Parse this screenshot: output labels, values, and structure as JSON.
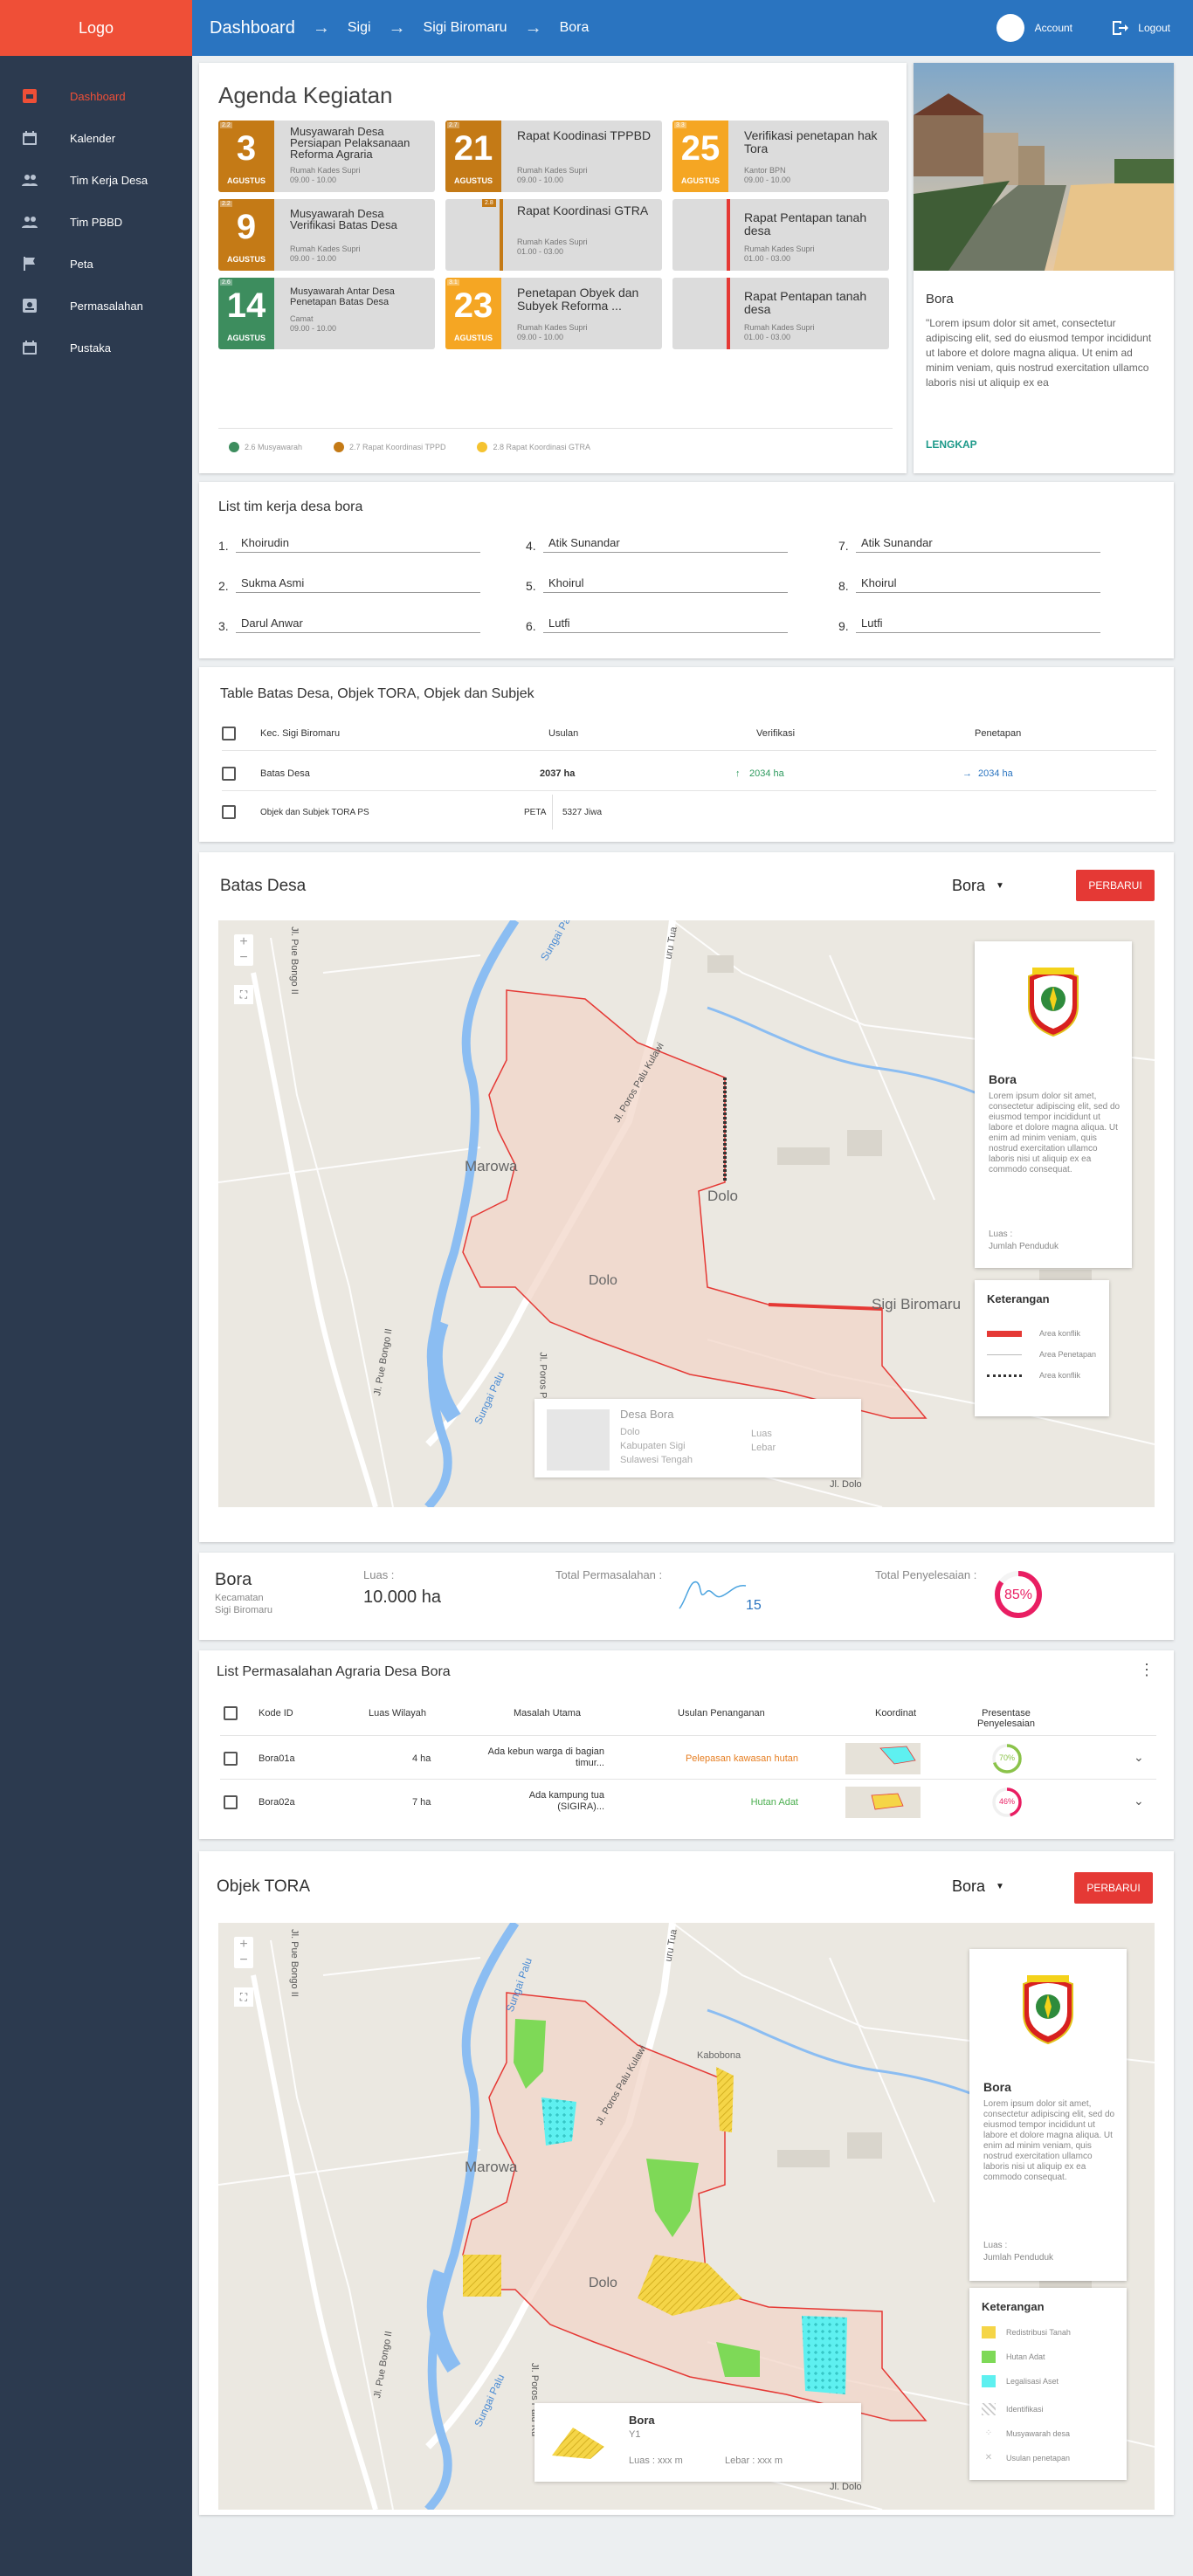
{
  "sidebar": {
    "logo": "Logo",
    "items": [
      {
        "label": "Dashboard",
        "icon": "dashboard-icon",
        "active": true
      },
      {
        "label": "Kalender",
        "icon": "calendar-icon"
      },
      {
        "label": "Tim Kerja Desa",
        "icon": "people-icon"
      },
      {
        "label": "Tim PBBD",
        "icon": "people-icon"
      },
      {
        "label": "Peta",
        "icon": "flag-icon"
      },
      {
        "label": "Permasalahan",
        "icon": "inbox-icon"
      },
      {
        "label": "Pustaka",
        "icon": "calendar-icon"
      }
    ]
  },
  "header": {
    "breadcrumb": [
      "Dashboard",
      "Sigi",
      "Sigi Biromaru",
      "Bora"
    ],
    "account": "Account",
    "logout": "Logout"
  },
  "agenda": {
    "title": "Agenda Kegiatan",
    "events": [
      {
        "badge": "2.2",
        "day": "3",
        "month": "AGUSTUS",
        "title": "Musyawarah Desa Persiapan Pelaksanaan Reforma Agraria",
        "place": "Rumah Kades Supri",
        "time": "09.00 - 10.00",
        "color": "#c47a16"
      },
      {
        "badge": "2.2",
        "day": "9",
        "month": "AGUSTUS",
        "title": "Musyawarah Desa Verifikasi Batas Desa",
        "place": "Rumah Kades Supri",
        "time": "09.00 - 10.00",
        "color": "#c47a16"
      },
      {
        "badge": "2.6",
        "day": "14",
        "month": "AGUSTUS",
        "title": "Musyawarah Antar Desa Penetapan Batas Desa",
        "place": "Camat",
        "time": "09.00 - 10.00",
        "color": "#3d8d5e"
      },
      {
        "badge": "2.7",
        "day": "21",
        "month": "AGUSTUS",
        "title": "Rapat Koodinasi TPPBD",
        "place": "Rumah Kades Supri",
        "time": "09.00 - 10.00",
        "color": "#c47a16"
      },
      {
        "badge": "2.8",
        "day": "",
        "month": "",
        "title": "Rapat Koordinasi GTRA",
        "place": "Rumah Kades Supri",
        "time": "01.00 - 03.00",
        "color": "#c47a16"
      },
      {
        "badge": "3.1",
        "day": "23",
        "month": "AGUSTUS",
        "title": "Penetapan Obyek dan Subyek Reforma ...",
        "place": "Rumah Kades Supri",
        "time": "09.00 - 10.00",
        "color": "#f5a623"
      },
      {
        "badge": "3.3",
        "day": "25",
        "month": "AGUSTUS",
        "title": "Verifikasi penetapan hak Tora",
        "place": "Kantor BPN",
        "time": "09.00 - 10.00",
        "color": "#f5a623"
      },
      {
        "badge": "",
        "day": "",
        "month": "",
        "title": "Rapat Pentapan tanah desa",
        "place": "Rumah Kades Supri",
        "time": "01.00 - 03.00",
        "color": "#e53935"
      },
      {
        "badge": "",
        "day": "",
        "month": "",
        "title": "Rapat Pentapan tanah desa",
        "place": "Rumah Kades Supri",
        "time": "01.00 - 03.00",
        "color": "#e53935"
      }
    ],
    "legend": [
      {
        "label": "2.6 Musyawarah",
        "color": "#3d8d5e"
      },
      {
        "label": "2.7 Rapat Koordinasi TPPD",
        "color": "#c47a16"
      },
      {
        "label": "2.8 Rapat Koordinasi GTRA",
        "color": "#f5c330"
      }
    ]
  },
  "village_card": {
    "name": "Bora",
    "text": "\"Lorem ipsum dolor sit amet, consectetur adipiscing elit, sed do eiusmod tempor incididunt ut labore et dolore magna aliqua. Ut enim ad minim veniam, quis nostrud exercitation ullamco laboris nisi ut aliquip ex ea",
    "link": "LENGKAP"
  },
  "tim": {
    "title": "List tim kerja desa bora",
    "members": [
      {
        "n": "1.",
        "name": "Khoirudin"
      },
      {
        "n": "2.",
        "name": "Sukma Asmi"
      },
      {
        "n": "3.",
        "name": "Darul Anwar"
      },
      {
        "n": "4.",
        "name": "Atik Sunandar"
      },
      {
        "n": "5.",
        "name": "Khoirul"
      },
      {
        "n": "6.",
        "name": "Lutfi"
      },
      {
        "n": "7.",
        "name": "Atik Sunandar"
      },
      {
        "n": "8.",
        "name": "Khoirul"
      },
      {
        "n": "9.",
        "name": "Lutfi"
      }
    ]
  },
  "batas_table": {
    "title": "Table Batas Desa, Objek TORA, Objek dan Subjek",
    "headers": [
      "Kec. Sigi Biromaru",
      "Usulan",
      "Verifikasi",
      "Penetapan"
    ],
    "row1": {
      "label": "Batas Desa",
      "usulan": "2037 ha",
      "verifikasi": "2034 ha",
      "penetapan": "2034 ha"
    },
    "row2": {
      "label": "Objek dan Subjek TORA PS",
      "peta": "PETA",
      "jiwa": "5327 Jiwa"
    }
  },
  "batas_map": {
    "title": "Batas Desa",
    "dropdown": "Bora",
    "button": "PERBARUI",
    "labels": [
      "Sungai Palu",
      "Jl. Pue Bongo II",
      "Jl. Poros Palu Kulawi",
      "Marowa",
      "Dolo",
      "Dolo",
      "Sigi Biromaru",
      "Jl. Pue Bongo II",
      "Sungai Palu",
      "Jl. Poros Palu Kulawi",
      "uru Tua",
      "Jl. Dolo"
    ],
    "zoom_in": "+",
    "zoom_out": "−",
    "info": {
      "name": "Bora",
      "text": "Lorem ipsum dolor sit amet, consectetur adipiscing elit, sed do eiusmod tempor incididunt ut labore et dolore magna aliqua. Ut enim ad minim veniam, quis nostrud exercitation ullamco laboris nisi ut aliquip ex ea commodo consequat.",
      "luas": "Luas :",
      "penduduk": "Jumlah Penduduk"
    },
    "keterangan": {
      "title": "Keterangan",
      "items": [
        {
          "label": "Area konflik",
          "color": "#e53935"
        },
        {
          "label": "Area Penetapan",
          "color": "#cccccc"
        },
        {
          "label": "Area konflik",
          "color": "#333333"
        }
      ]
    },
    "popup": {
      "name": "Desa Bora",
      "l1": "Dolo",
      "l2": "Kabupaten Sigi",
      "l3": "Sulawesi Tengah",
      "r1": "Luas",
      "r2": "Lebar"
    }
  },
  "summary": {
    "name": "Bora",
    "kec_label": "Kecamatan",
    "kec": "Sigi Biromaru",
    "luas_label": "Luas :",
    "luas": "10.000 ha",
    "permasalahan_label": "Total Permasalahan :",
    "permasalahan": "15",
    "penyelesaian_label": "Total Penyelesaian :",
    "penyelesaian": "85%",
    "penyelesaian_value": 0.85
  },
  "permasalahan": {
    "title": "List Permasalahan Agraria Desa Bora",
    "headers": [
      "Kode ID",
      "Luas Wilayah",
      "Masalah Utama",
      "Usulan Penanganan",
      "Koordinat",
      "Presentase Penyelesaian"
    ],
    "rows": [
      {
        "id": "Bora01a",
        "luas": "4 ha",
        "masalah": "Ada kebun warga  di bagian timur...",
        "usulan": "Pelepasan kawasan hutan",
        "usulan_color": "#e67e22",
        "pct": "70%",
        "pct_value": 0.7,
        "ring_color": "#8bc34a"
      },
      {
        "id": "Bora02a",
        "luas": "7 ha",
        "masalah": "Ada kampung tua (SIGIRA)...",
        "usulan": "Hutan Adat",
        "usulan_color": "#4caf50",
        "pct": "46%",
        "pct_value": 0.46,
        "ring_color": "#e91e63"
      }
    ]
  },
  "tora_map": {
    "title": "Objek TORA",
    "dropdown": "Bora",
    "button": "PERBARUI",
    "labels": [
      "Sungai Palu",
      "Jl. Pue Bongo II",
      "Jl. Poros Palu Kulawi",
      "Marowa",
      "Dolo",
      "Kabobona",
      "Jl. Pue Bongo II",
      "Sungai Palu",
      "Jl. Poros Palu Ku",
      "uru Tua",
      "Jl. Dolo"
    ],
    "zoom_in": "+",
    "zoom_out": "−",
    "info": {
      "name": "Bora",
      "text": "Lorem ipsum dolor sit amet, consectetur adipiscing elit, sed do eiusmod tempor incididunt ut labore et dolore magna aliqua. Ut enim ad minim veniam, quis nostrud exercitation ullamco laboris nisi ut aliquip ex ea commodo consequat.",
      "luas": "Luas :",
      "penduduk": "Jumlah Penduduk"
    },
    "keterangan": {
      "title": "Keterangan",
      "items": [
        {
          "label": "Redistribusi Tanah",
          "color": "#f5d547"
        },
        {
          "label": "Hutan Adat",
          "color": "#7ed957"
        },
        {
          "label": "Legalisasi Aset",
          "color": "#5ef0f0"
        },
        {
          "label": "Identifikasi",
          "color": "#cccccc"
        },
        {
          "label": "Musyawarah desa",
          "color": "#cccccc"
        },
        {
          "label": "Usulan penetapan",
          "color": "#cccccc"
        }
      ]
    },
    "popup": {
      "name": "Bora",
      "sub": "Y1",
      "luas": "Luas : xxx m",
      "lebar": "Lebar : xxx m"
    }
  }
}
